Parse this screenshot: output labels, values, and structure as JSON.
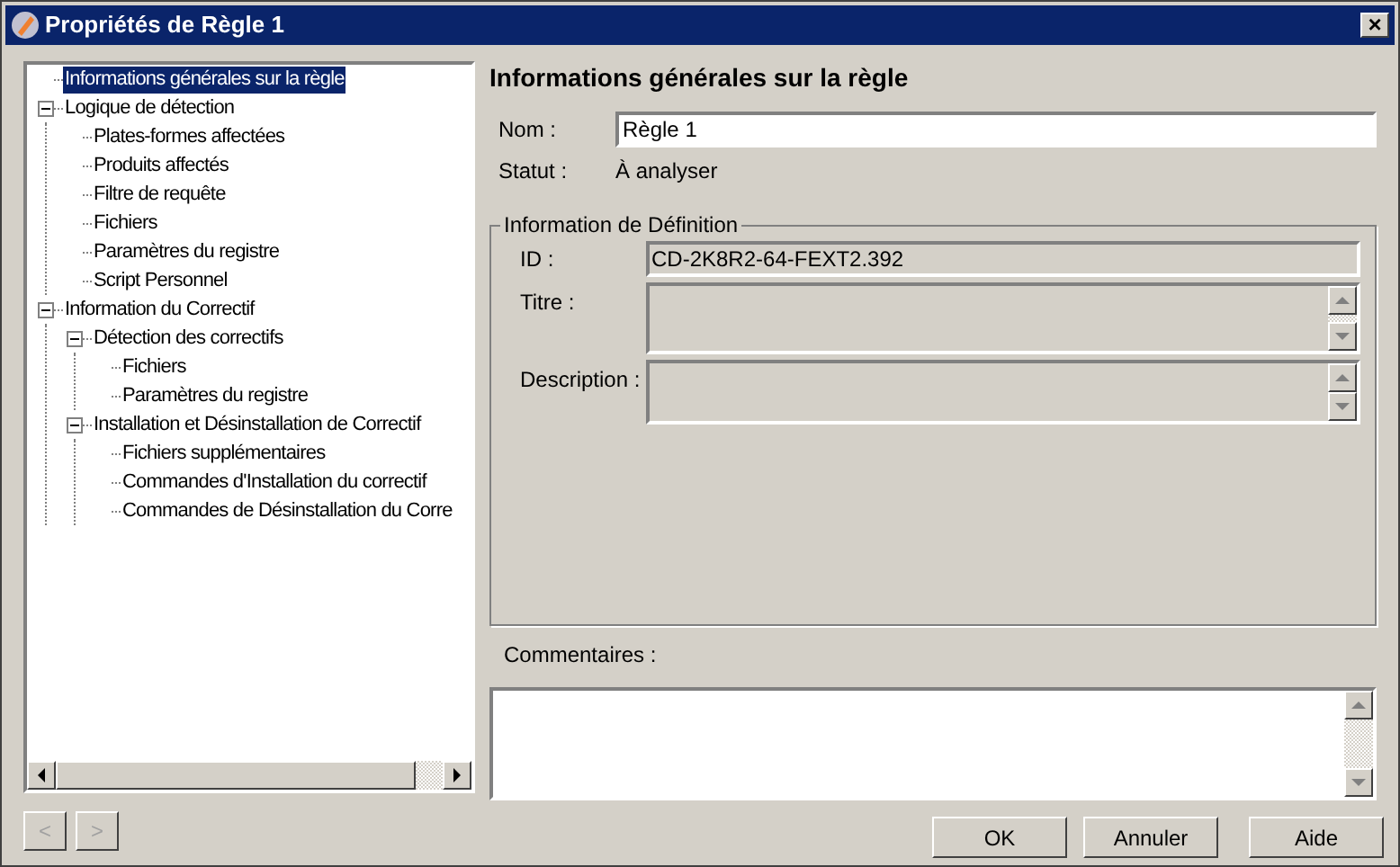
{
  "window": {
    "title": "Propriétés de Règle 1",
    "close": "×"
  },
  "tree": [
    {
      "label": "Informations générales sur la règle",
      "selected": true
    },
    {
      "label": "Logique de détection",
      "selected": false,
      "expanded": true,
      "children": [
        {
          "label": "Plates-formes affectées",
          "selected": false
        },
        {
          "label": "Produits affectés",
          "selected": false
        },
        {
          "label": "Filtre de requête",
          "selected": false
        },
        {
          "label": "Fichiers",
          "selected": false
        },
        {
          "label": "Paramètres du registre",
          "selected": false
        },
        {
          "label": "Script Personnel",
          "selected": false
        }
      ]
    },
    {
      "label": "Information du Correctif",
      "selected": false,
      "expanded": true,
      "children": [
        {
          "label": "Détection des correctifs",
          "selected": false,
          "expanded": true,
          "children": [
            {
              "label": "Fichiers",
              "selected": false
            },
            {
              "label": "Paramètres du registre",
              "selected": false
            }
          ]
        },
        {
          "label": "Installation et Désinstallation de Correctif",
          "selected": false,
          "expanded": true,
          "children": [
            {
              "label": "Fichiers supplémentaires",
              "selected": false
            },
            {
              "label": "Commandes d'Installation du correctif",
              "selected": false
            },
            {
              "label": "Commandes de Désinstallation du Corre",
              "selected": false
            }
          ]
        }
      ]
    }
  ],
  "heading": "Informations générales sur la règle",
  "name": {
    "label": "Nom :",
    "value": "Règle 1"
  },
  "status": {
    "label": "Statut :",
    "value": "À analyser"
  },
  "definition": {
    "legend": "Information de Définition",
    "id_label": "ID :",
    "id_value": "CD-2K8R2-64-FEXT2.392",
    "title_label": "Titre :",
    "description_label": "Description :"
  },
  "comments": {
    "label": "Commentaires :"
  },
  "nav": [
    {
      "label": "<",
      "disabled": true
    },
    {
      "label": ">",
      "disabled": true
    }
  ],
  "buttons": [
    "OK",
    "Annuler",
    "Aide"
  ]
}
